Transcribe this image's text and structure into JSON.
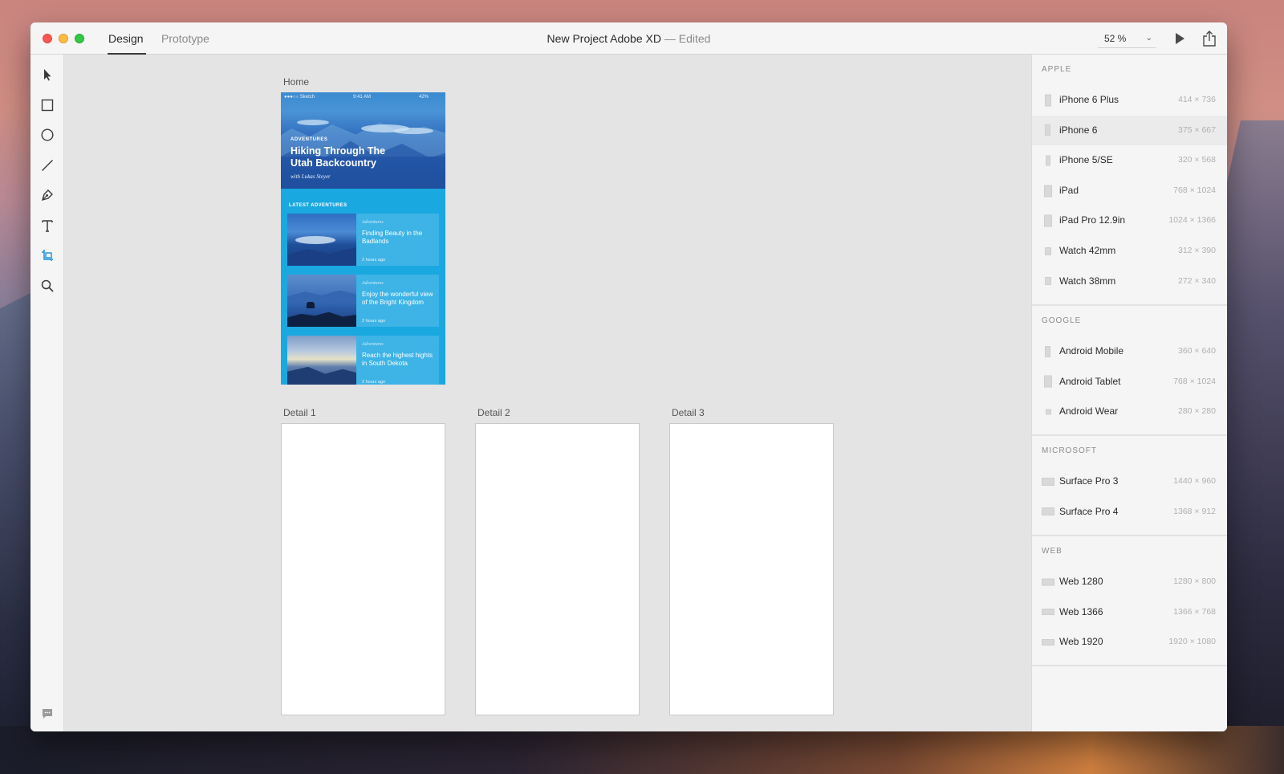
{
  "window": {
    "tabs": [
      "Design",
      "Prototype"
    ],
    "title": "New Project Adobe XD",
    "title_suffix": "— Edited",
    "zoom": "52 %",
    "zoom_chevron": "⌄"
  },
  "tools": [
    "select",
    "rectangle",
    "ellipse",
    "line",
    "pen",
    "text",
    "artboard",
    "zoom"
  ],
  "artboards": {
    "home": {
      "label": "Home",
      "status": {
        "carrier": "●●●○○ Sketch",
        "time": "9:41 AM",
        "battery": "42%"
      },
      "hero": {
        "kicker": "ADVENTURES",
        "title": "Hiking  Through The Utah Backcountry",
        "byline": "with Lukas Steyer"
      },
      "latest_heading": "LATEST ADVENTURES",
      "cards": [
        {
          "category": "Adventures",
          "title": "Finding Beauty in the Badlands",
          "time": "2 hours ago"
        },
        {
          "category": "Adventures",
          "title": "Enjoy the wonderful view of the Bright Kingdom",
          "time": "2 hours ago"
        },
        {
          "category": "Adventures",
          "title": "Reach the highest hights in South Dekota",
          "time": "2 hours ago"
        }
      ]
    },
    "details": [
      "Detail 1",
      "Detail 2",
      "Detail 3"
    ]
  },
  "presets": {
    "apple": {
      "heading": "APPLE",
      "items": [
        {
          "name": "iPhone 6 Plus",
          "size": "414 × 736"
        },
        {
          "name": "iPhone 6",
          "size": "375 × 667"
        },
        {
          "name": "iPhone 5/SE",
          "size": "320 × 568"
        },
        {
          "name": "iPad",
          "size": "768 × 1024"
        },
        {
          "name": "iPad Pro 12.9in",
          "size": "1024 × 1366"
        },
        {
          "name": "Watch 42mm",
          "size": "312 × 390"
        },
        {
          "name": "Watch 38mm",
          "size": "272 × 340"
        }
      ]
    },
    "google": {
      "heading": "GOOGLE",
      "items": [
        {
          "name": "Android Mobile",
          "size": "360 × 640"
        },
        {
          "name": "Android Tablet",
          "size": "768 × 1024"
        },
        {
          "name": "Android Wear",
          "size": "280 × 280"
        }
      ]
    },
    "microsoft": {
      "heading": "MICROSOFT",
      "items": [
        {
          "name": "Surface Pro 3",
          "size": "1440 × 960"
        },
        {
          "name": "Surface Pro 4",
          "size": "1368 × 912"
        }
      ]
    },
    "web": {
      "heading": "WEB",
      "items": [
        {
          "name": "Web 1280",
          "size": "1280 × 800"
        },
        {
          "name": "Web 1366",
          "size": "1366 × 768"
        },
        {
          "name": "Web 1920",
          "size": "1920 × 1080"
        }
      ]
    }
  },
  "colors": {
    "accent": "#1a8fe0",
    "home_background": "#1aa8e0",
    "card_background": "#3db3e6"
  }
}
